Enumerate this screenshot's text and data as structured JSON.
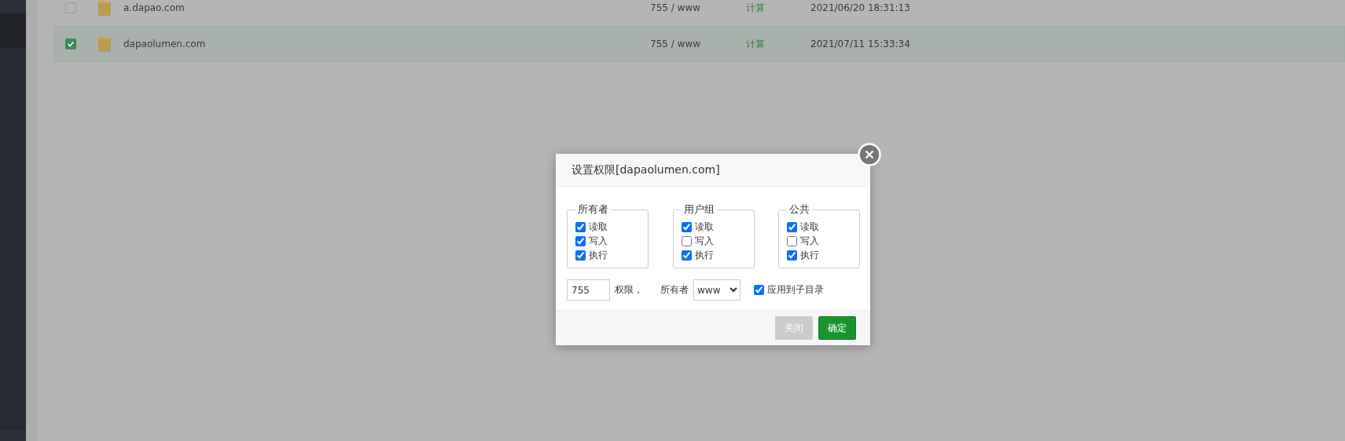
{
  "file_rows": [
    {
      "name": "a.dapao.com",
      "permission": "755 / www",
      "size_action": "计算",
      "modified": "2021/06/20 18:31:13",
      "selected": false
    },
    {
      "name": "dapaolumen.com",
      "permission": "755 / www",
      "size_action": "计算",
      "modified": "2021/07/11 15:33:34",
      "selected": true
    }
  ],
  "dialog": {
    "title": "设置权限[dapaolumen.com]",
    "groups": [
      {
        "legend": "所有者",
        "options": [
          {
            "label": "读取",
            "checked": true
          },
          {
            "label": "写入",
            "checked": true
          },
          {
            "label": "执行",
            "checked": true
          }
        ]
      },
      {
        "legend": "用户组",
        "options": [
          {
            "label": "读取",
            "checked": true
          },
          {
            "label": "写入",
            "checked": false
          },
          {
            "label": "执行",
            "checked": true
          }
        ]
      },
      {
        "legend": "公共",
        "options": [
          {
            "label": "读取",
            "checked": true
          },
          {
            "label": "写入",
            "checked": false
          },
          {
            "label": "执行",
            "checked": true
          }
        ]
      }
    ],
    "permission_value": "755",
    "permission_label": "权限，",
    "owner_label": "所有者",
    "owner_value": "www",
    "apply_subdirs": {
      "label": "应用到子目录",
      "checked": true
    },
    "buttons": [
      {
        "label": "关闭",
        "kind": "secondary"
      },
      {
        "label": "确定",
        "kind": "primary"
      }
    ]
  }
}
